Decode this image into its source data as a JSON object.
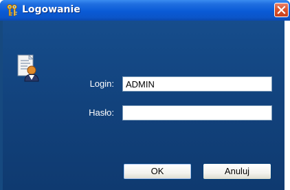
{
  "window": {
    "title": "Logowanie"
  },
  "form": {
    "login_label": "Login:",
    "login_value": "ADMIN",
    "password_label": "Hasło:",
    "password_value": ""
  },
  "buttons": {
    "ok_label": "OK",
    "cancel_label": "Anuluj"
  },
  "icons": {
    "title": "keys-icon",
    "user": "user-document-icon",
    "close": "close-icon"
  },
  "colors": {
    "titlebar": "#0a5ad6",
    "client_background": "#12427c",
    "close_button": "#d9532e"
  }
}
